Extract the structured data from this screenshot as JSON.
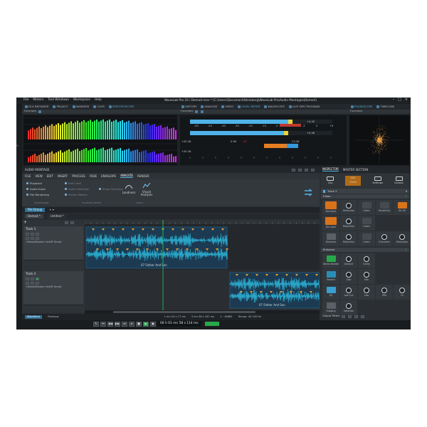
{
  "menu": [
    "File",
    "Meters",
    "Tool Windows",
    "Workspace",
    "Help"
  ],
  "window_title": "WaveLab Pro 10 / Demo4.mon * [C:\\Users\\Document\\Steinberg\\WaveLab Pro\\Audio Montages\\Demo4]",
  "top_tabs": {
    "left": [
      {
        "label": "FILE BROWSER",
        "active": false
      },
      {
        "label": "PROJECT",
        "active": false
      },
      {
        "label": "MARKERS",
        "active": false
      },
      {
        "label": "CLIPS",
        "active": false
      },
      {
        "label": "SPECTROSCOPE",
        "active": true
      }
    ],
    "middle": [
      {
        "label": "HISTORY",
        "active": false
      },
      {
        "label": "ANALYSIS",
        "active": false
      },
      {
        "label": "VIDEO",
        "active": false
      },
      {
        "label": "LEVEL METER",
        "active": true
      },
      {
        "label": "WAVESCOPE",
        "active": false
      },
      {
        "label": "LIVE SPECTROGRAM",
        "active": false
      }
    ],
    "right": [
      {
        "label": "PHASESCOPE",
        "active": true
      },
      {
        "label": "TIMECODE",
        "active": false
      }
    ]
  },
  "functions_label": "Functions",
  "meter": {
    "scale": [
      "-60",
      "-50",
      "-40",
      "-30",
      "-20",
      "-15",
      "-9",
      "-6",
      "-3",
      "0",
      "+6"
    ],
    "readings": [
      "+20.18",
      "+20.18",
      "-5.90",
      "-12.34",
      "+4.45",
      "+0.48"
    ],
    "bars_fill": [
      0.72,
      0.69
    ],
    "peak_left": "-17",
    "peak_right": "+0.0"
  },
  "montage": {
    "title": "AUDIO MONTAGE",
    "menu": [
      "FILE",
      "VIEW",
      "EDIT",
      "INSERT",
      "PROCESS",
      "FADE",
      "ENVELOPE",
      "ANALYZE",
      "RENDER"
    ],
    "active_menu": "ANALYZE",
    "tools": {
      "monitoring": [
        "Playback",
        "Audio Input",
        "File Rendering"
      ],
      "monitoring2": [
        "Edit Limit",
        "Audio Selection",
        "Freeze Meters"
      ],
      "monitoring3": [
        "Show Selection"
      ],
      "loudness": "Loudness",
      "visual": "Visual Analysis",
      "groups": [
        "MONITORING",
        "PLAYBACK METER",
        "TOOLS"
      ]
    },
    "file_group": "File Group",
    "tabs": [
      "Demo4 *",
      "Untitled *"
    ],
    "tracks": [
      {
        "name": "Track 1",
        "plugin": "<Mono/Stereo> Intel® Smart",
        "clip": "07 Father And Son"
      },
      {
        "name": "Track 2",
        "plugin": "<Mono/Stereo> Intel® Smart",
        "clip": "07 Father And Son"
      }
    ],
    "bottom": {
      "waveform": "Waveform",
      "rainbow": "Rainbow",
      "t1": "1 mn 54 s 77 ms",
      "t2": "3 mn 38 s 167 ms",
      "rate": "1 : 16683",
      "tempo": "Tempo: 44 100 Hz"
    }
  },
  "transport": {
    "time": "00 h 01 mn 58 s 114 ms"
  },
  "inspector": {
    "tabs": [
      "INSPECTOR",
      "MASTER SECTION"
    ],
    "top_icons": [
      "Clip",
      "Track",
      "Settings",
      "Output"
    ],
    "track": "Track 2",
    "track_value": "000",
    "sections": [
      {
        "title": "Clean",
        "mods": [
          {
            "label": "Declicker",
            "kind": "orange"
          },
          {
            "label": "Reduction",
            "kind": "knob"
          },
          {
            "label": "Listen",
            "kind": "dim"
          },
          {
            "label": "Sensitivity",
            "kind": "dim"
          },
          {
            "label": "All Hit",
            "kind": "orange-small"
          },
          {
            "label": "De-noise",
            "kind": "orange"
          },
          {
            "label": "Reduction",
            "kind": "knob"
          },
          {
            "label": "Listen",
            "kind": "dim"
          },
          {
            "label": "",
            "kind": "empty"
          },
          {
            "label": "",
            "kind": "empty"
          },
          {
            "label": "Denoiser",
            "kind": "grey"
          },
          {
            "label": "Reduction",
            "kind": "knob"
          },
          {
            "label": "Listen",
            "kind": "dim"
          },
          {
            "label": "Character",
            "kind": "knob"
          },
          {
            "label": "Reduction",
            "kind": "knob"
          }
        ]
      },
      {
        "title": "Enhance",
        "mods": [
          {
            "label": "Stereo Builder",
            "kind": "green"
          },
          {
            "label": "Amount",
            "kind": "knob"
          },
          {
            "label": "Clarity",
            "kind": "knob"
          },
          {
            "label": "",
            "kind": "empty"
          },
          {
            "label": "",
            "kind": "empty"
          },
          {
            "label": "Reverb",
            "kind": "teal"
          },
          {
            "label": "Size",
            "kind": "knob"
          },
          {
            "label": "Mix",
            "kind": "knob"
          },
          {
            "label": "",
            "kind": "empty"
          },
          {
            "label": "",
            "kind": "empty"
          },
          {
            "label": "EQ",
            "kind": "teal2"
          },
          {
            "label": "Low Cut",
            "kind": "knob"
          },
          {
            "label": "Low",
            "kind": "knob"
          },
          {
            "label": "Mid",
            "kind": "knob"
          },
          {
            "label": "Hi",
            "kind": "knob"
          },
          {
            "label": "Imaging",
            "kind": "grey"
          },
          {
            "label": "Optimize",
            "kind": "knob"
          }
        ]
      }
    ],
    "output_filters": "Output Filters"
  },
  "colors": {
    "accent": "#4fb3e8",
    "waveform": "#2aa6c9",
    "orange": "#e8a032",
    "green_button": "#27a84a"
  }
}
